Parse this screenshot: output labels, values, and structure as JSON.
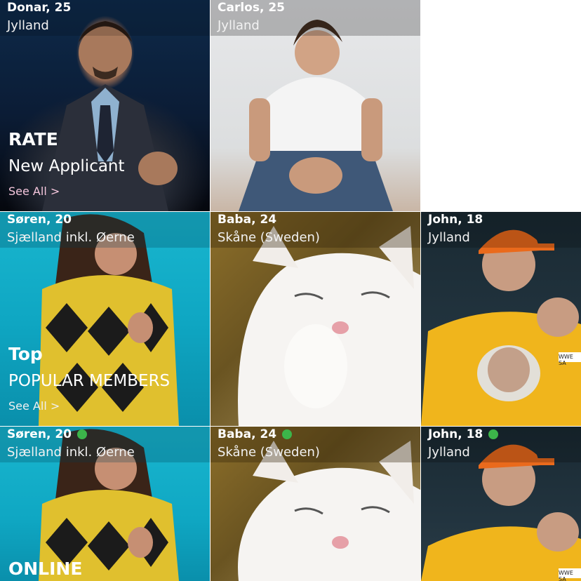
{
  "tiles": [
    {
      "name_age": "Donar, 25",
      "region": "Jylland",
      "online": false,
      "category": {
        "title": "RATE",
        "subtitle": "New Applicant",
        "see_all": "See All >"
      }
    },
    {
      "name_age": "Carlos, 25",
      "region": "Jylland",
      "online": false
    },
    {
      "name_age": "Søren, 20",
      "region": "Sjælland inkl. Øerne",
      "online": false,
      "category": {
        "title": "Top",
        "subtitle": "POPULAR MEMBERS",
        "see_all": "See All >"
      }
    },
    {
      "name_age": "Baba, 24",
      "region": "Skåne (Sweden)",
      "online": false
    },
    {
      "name_age": "John, 18",
      "region": "Jylland",
      "online": false,
      "badge_text": "WWE SA"
    },
    {
      "name_age": "Søren, 20",
      "region": "Sjælland inkl. Øerne",
      "online": true,
      "category": {
        "title": "ONLINE"
      }
    },
    {
      "name_age": "Baba, 24",
      "region": "Skåne (Sweden)",
      "online": true
    },
    {
      "name_age": "John, 18",
      "region": "Jylland",
      "online": true,
      "badge_text": "WWE SA"
    }
  ],
  "colors": {
    "online_dot": "#3cb54a",
    "see_all_pink": "#f4c6dc"
  }
}
